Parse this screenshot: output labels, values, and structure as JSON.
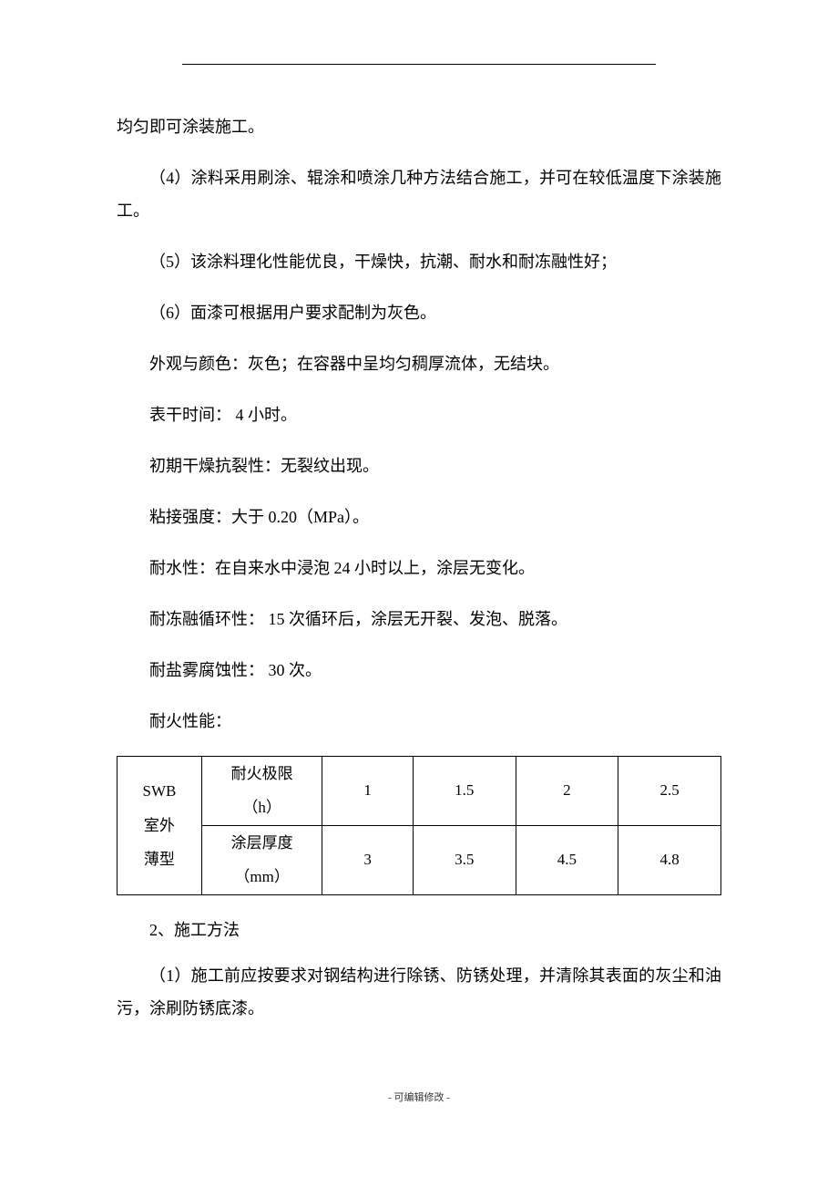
{
  "body": {
    "p0": "均匀即可涂装施工。",
    "p1": "（4）涂料采用刷涂、辊涂和喷涂几种方法结合施工，并可在较低温度下涂装施工。",
    "p2": "（5）该涂料理化性能优良，干燥快，抗潮、耐水和耐冻融性好；",
    "p3": "（6）面漆可根据用户要求配制为灰色。",
    "p4": "外观与颜色：灰色；在容器中呈均匀稠厚流体，无结块。",
    "p5": "表干时间：  4 小时。",
    "p6": "初期干燥抗裂性：无裂纹出现。",
    "p7": "粘接强度：大于  0.20（MPa）。",
    "p8": "耐水性：在自来水中浸泡  24 小时以上，涂层无变化。",
    "p9": "耐冻融循环性：  15 次循环后，涂层无开裂、发泡、脱落。",
    "p10": "耐盐雾腐蚀性：  30 次。",
    "p11": "耐火性能：",
    "heading2": "2、施工方法",
    "p12": "（1）施工前应按要求对钢结构进行除锈、防锈处理，并清除其表面的灰尘和油污，涂刷防锈底漆。"
  },
  "table": {
    "rowhead_line1": "SWB",
    "rowhead_line2": "室外",
    "rowhead_line3": "薄型",
    "r1_label_line1": "耐火极限",
    "r1_label_line2": "（h）",
    "r1_v1": "1",
    "r1_v2": "1.5",
    "r1_v3": "2",
    "r1_v4": "2.5",
    "r2_label_line1": "涂层厚度",
    "r2_label_line2": "（mm）",
    "r2_v1": "3",
    "r2_v2": "3.5",
    "r2_v3": "4.5",
    "r2_v4": "4.8"
  },
  "chart_data": {
    "type": "table",
    "row_header": "SWB 室外薄型",
    "rows": [
      {
        "label": "耐火极限（h）",
        "values": [
          1,
          1.5,
          2,
          2.5
        ]
      },
      {
        "label": "涂层厚度（mm）",
        "values": [
          3,
          3.5,
          4.5,
          4.8
        ]
      }
    ]
  },
  "footer": "- 可编辑修改 -"
}
